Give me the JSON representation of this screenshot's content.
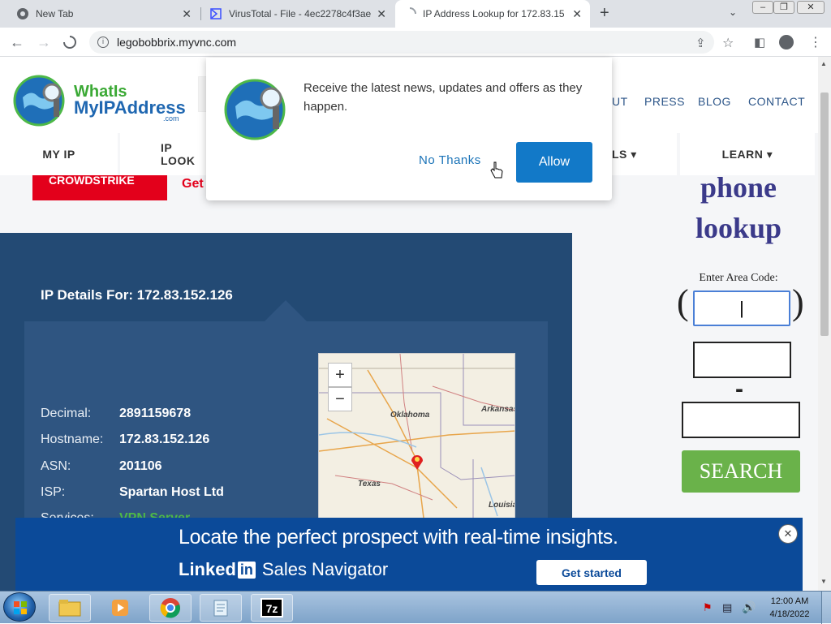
{
  "browser": {
    "tabs": [
      {
        "title": "New Tab",
        "active": false,
        "icon": "chrome-icon"
      },
      {
        "title": "VirusTotal - File - 4ec2278c4f3ae",
        "active": false,
        "icon": "virustotal-icon"
      },
      {
        "title": "IP Address Lookup for 172.83.15",
        "active": true,
        "icon": "loading-spinner-icon"
      }
    ],
    "new_tab_symbol": "+",
    "url": "legobobbrix.myvnc.com"
  },
  "site": {
    "logo_line1": "WhatIs",
    "logo_line2": "MyIPAddress",
    "logo_line3": ".com",
    "top_nav": [
      "UT",
      "PRESS",
      "BLOG",
      "CONTACT"
    ],
    "main_nav": [
      "MY IP",
      "IP LOOK",
      "LS ▾",
      "LEARN ▾"
    ],
    "ad_strip_brand": "CROWDSTRIKE",
    "ad_strip_text": "Get"
  },
  "popup": {
    "message": "Receive the latest news, updates and offers as they happen.",
    "no_thanks": "No Thanks",
    "allow": "Allow"
  },
  "ip_details": {
    "heading": "IP Details For: 172.83.152.126",
    "rows": [
      {
        "label": "Decimal:",
        "value": "2891159678"
      },
      {
        "label": "Hostname:",
        "value": "172.83.152.126"
      },
      {
        "label": "ASN:",
        "value": "201106"
      },
      {
        "label": "ISP:",
        "value": "Spartan Host Ltd"
      },
      {
        "label": "Services:",
        "value": "VPN Server"
      }
    ]
  },
  "map": {
    "zoom_in": "+",
    "zoom_out": "−",
    "labels": [
      "Oklahoma",
      "Arkansas",
      "Texas",
      "Louisia"
    ]
  },
  "sidebar": {
    "title_line1": "phone",
    "title_line2": "lookup",
    "area_code_label": "Enter Area Code:",
    "paren_open": "(",
    "paren_close": ")",
    "dash": "-",
    "search": "SEARCH"
  },
  "ad": {
    "headline": "Locate the perfect prospect with real-time insights.",
    "brand": "Linked",
    "brand_in": "in",
    "product": "Sales Navigator",
    "cta": "Get started"
  },
  "taskbar": {
    "time": "12:00 AM",
    "date": "4/18/2022"
  }
}
